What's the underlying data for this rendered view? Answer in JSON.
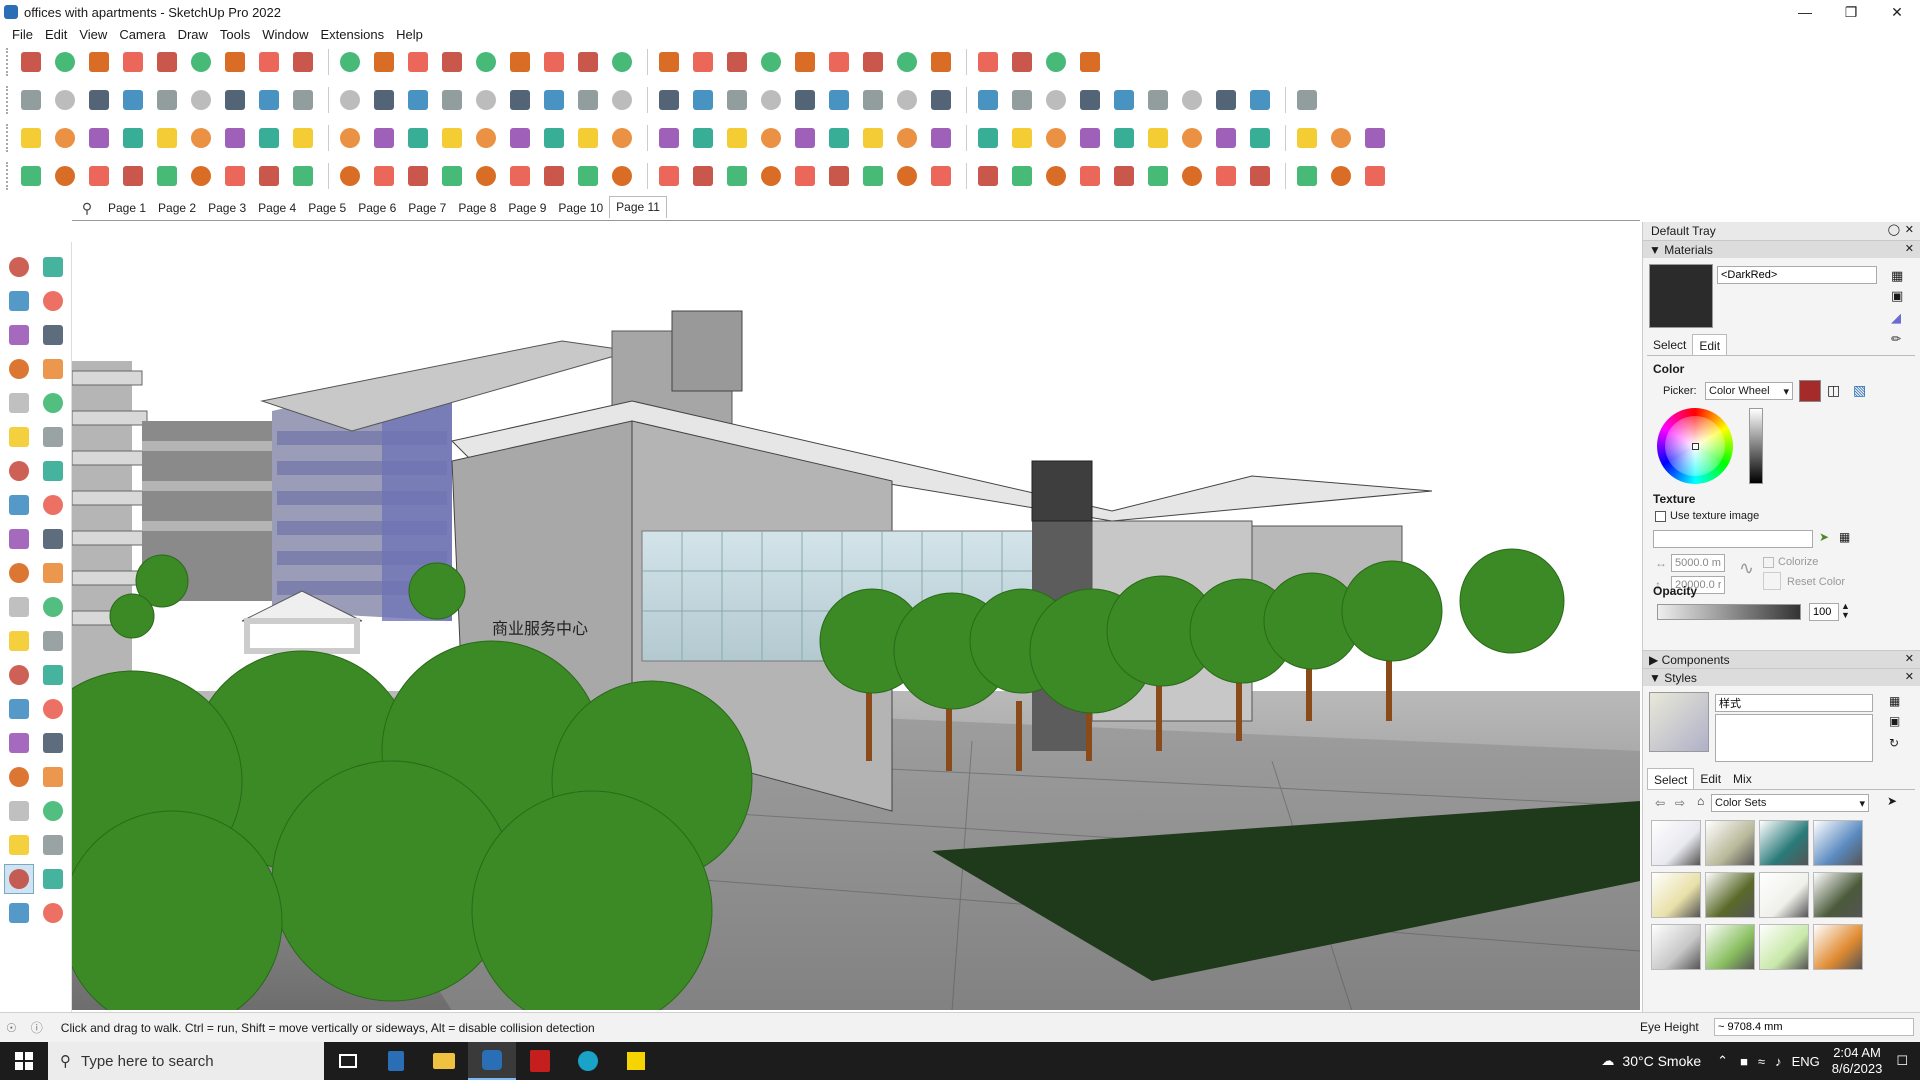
{
  "window": {
    "title": "offices with apartments - SketchUp Pro 2022",
    "controls": [
      "—",
      "❐",
      "✕"
    ]
  },
  "menu": [
    "File",
    "Edit",
    "View",
    "Camera",
    "Draw",
    "Tools",
    "Window",
    "Extensions",
    "Help"
  ],
  "pages": [
    "Page 1",
    "Page 2",
    "Page 3",
    "Page 4",
    "Page 5",
    "Page 6",
    "Page 7",
    "Page 8",
    "Page 9",
    "Page 10",
    "Page 11"
  ],
  "active_page": "Page 11",
  "viewport": {
    "sign_text": "商业服务中心"
  },
  "tray": {
    "title": "Default Tray",
    "materials": {
      "header": "Materials",
      "name": "<DarkRed>",
      "tabs": [
        "Select",
        "Edit"
      ],
      "color_label": "Color",
      "picker_label": "Picker:",
      "picker_value": "Color Wheel",
      "texture_label": "Texture",
      "use_texture": "Use texture image",
      "width": "5000.0 m",
      "height": "20000.0 r",
      "colorize": "Colorize",
      "reset_color": "Reset Color",
      "opacity_label": "Opacity",
      "opacity_value": "100",
      "swatch_color": "#a52a2a",
      "preview_color": "#2b2b2b"
    },
    "components": {
      "header": "Components"
    },
    "styles": {
      "header": "Styles",
      "name": "样式",
      "tabs": [
        "Select",
        "Edit",
        "Mix"
      ],
      "collection": "Color Sets"
    }
  },
  "status": {
    "hint": "Click and drag to walk.  Ctrl = run, Shift = move vertically or sideways, Alt = disable collision detection",
    "measure_label": "Eye Height",
    "measure_value": "~ 9708.4 mm"
  },
  "taskbar": {
    "search_placeholder": "Type here to search",
    "weather": "30°C  Smoke",
    "lang": "ENG",
    "time": "2:04 AM",
    "date": "8/6/2023"
  },
  "icons": [
    "search-icon",
    "select-icon",
    "eraser-icon",
    "pencil-icon",
    "orbit-icon",
    "pan-icon",
    "zoom-icon",
    "walk-icon",
    "look-around-icon",
    "house-icon",
    "windows-start-icon"
  ]
}
